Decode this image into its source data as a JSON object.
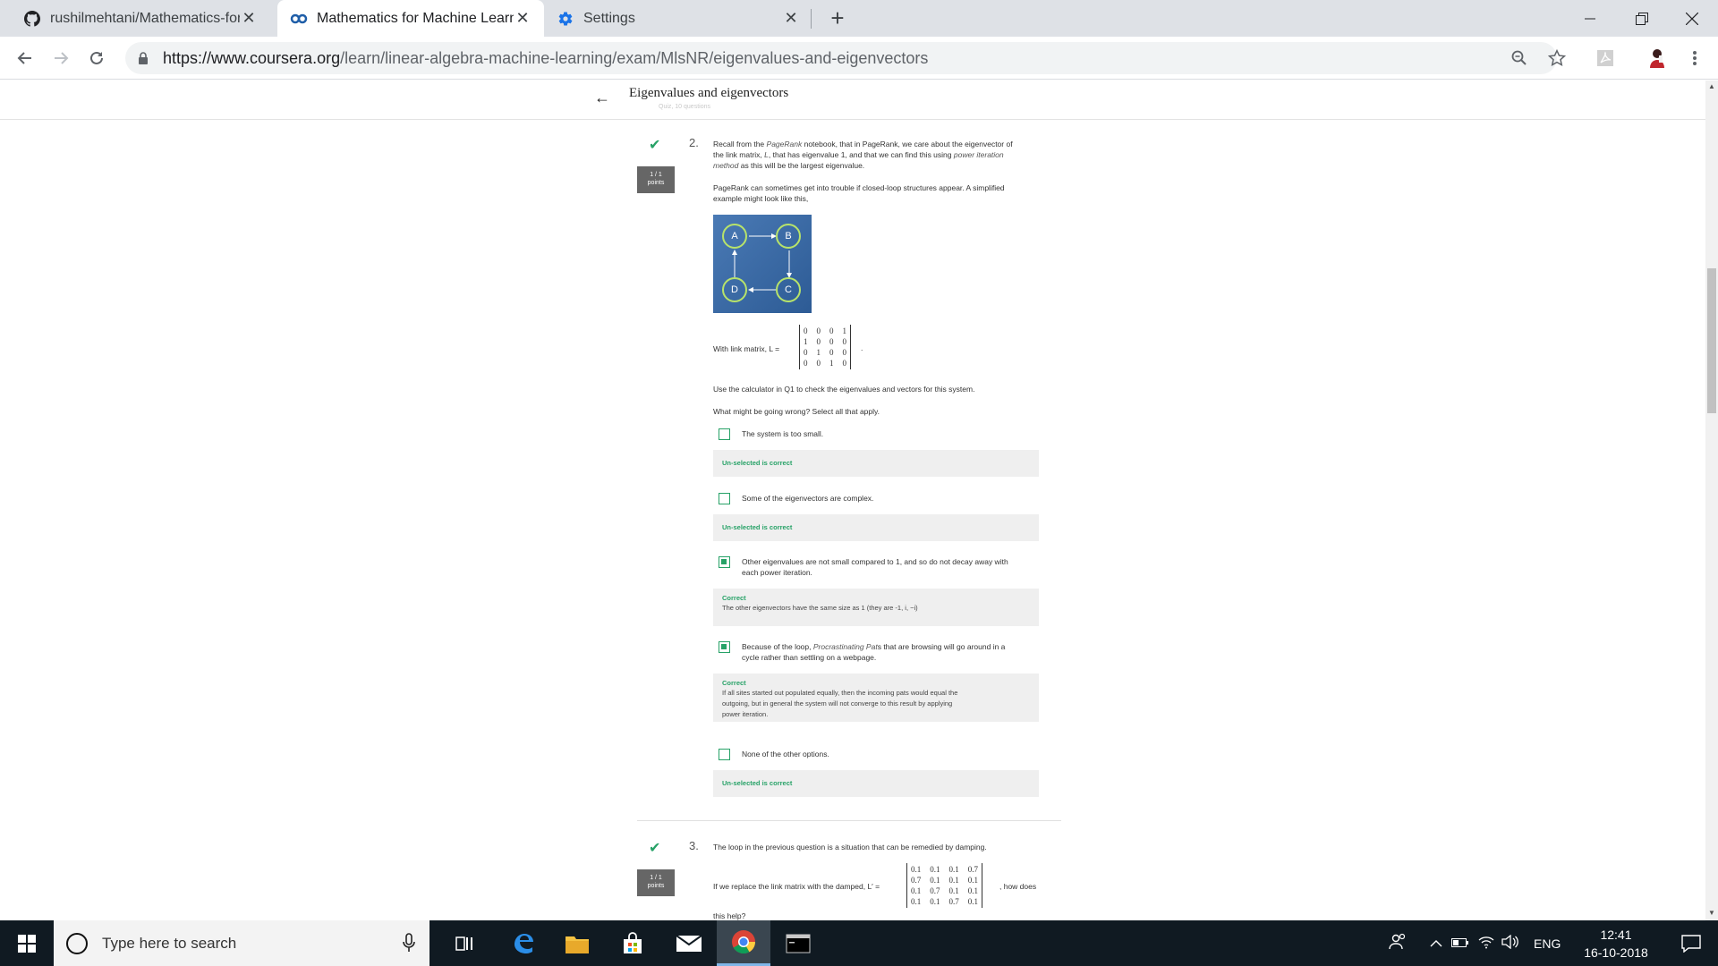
{
  "browser": {
    "tabs": [
      {
        "title": "rushilmehtani/Mathematics-for-M",
        "icon": "github-icon",
        "close": "✕"
      },
      {
        "title": "Mathematics for Machine Learnin",
        "icon": "coursera-icon",
        "close": "✕"
      },
      {
        "title": "Settings",
        "icon": "gear-icon",
        "close": "✕"
      }
    ],
    "new_tab": "+",
    "url_host": "https://www.coursera.org",
    "url_path": "/learn/linear-algebra-machine-learning/exam/MlsNR/eigenvalues-and-eigenvectors"
  },
  "quiz": {
    "title": "Eigenvalues and eigenvectors",
    "subtitle": "Quiz, 10 questions",
    "back": "←"
  },
  "q2": {
    "number": "2.",
    "points_line1": "1 / 1",
    "points_line2": "points",
    "intro_a": "Recall from the ",
    "intro_pagerank_italic": "PageRank",
    "intro_b": " notebook, that in PageRank, we care about the eigenvector of",
    "intro_c": "the link matrix, ",
    "intro_L": "L",
    "intro_d": ", that has eigenvalue 1, and that we can find this using ",
    "intro_power_italic": "power iteration",
    "intro_method_italic": "method",
    "intro_e": " as this will be the largest eigenvalue.",
    "trouble_line1": "PageRank can sometimes get into trouble if closed-loop structures appear. A simplified",
    "trouble_line2": "example might look like this,",
    "nodes": [
      "A",
      "B",
      "C",
      "D"
    ],
    "matrix_label": "With link matrix, L =",
    "matrix_rows": [
      [
        "0",
        "0",
        "0",
        "1"
      ],
      [
        "1",
        "0",
        "0",
        "0"
      ],
      [
        "0",
        "1",
        "0",
        "0"
      ],
      [
        "0",
        "0",
        "1",
        "0"
      ]
    ],
    "matrix_end": ".",
    "calc_note": "Use the calculator in Q1 to check the eigenvalues and vectors for this system.",
    "prompt": "What might be going wrong? Select all that apply.",
    "options": [
      {
        "text": "The system is too small.",
        "fb_title": "Un-selected is correct",
        "fb_body": ""
      },
      {
        "text": "Some of the eigenvectors are complex.",
        "fb_title": "Un-selected is correct",
        "fb_body": ""
      },
      {
        "text_l1": "Other eigenvalues are not small compared to 1, and so do not decay away with",
        "text_l2": "each power iteration.",
        "fb_title": "Correct",
        "fb_body": "The other eigenvectors have the same size as 1 (they are -1, i, −i)"
      },
      {
        "text_l1a": "Because of the loop, ",
        "text_l1_italic": "Procrastinating Pat",
        "text_l1b": "s that are browsing will go around in a",
        "text_l2": "cycle rather than settling on a webpage.",
        "fb_title": "Correct",
        "fb_body_l1": "If all sites started out populated equally, then the incoming pats would equal the",
        "fb_body_l2": "outgoing, but in general the system will not converge to this result by applying",
        "fb_body_l3": "power iteration."
      },
      {
        "text": "None of the other options.",
        "fb_title": "Un-selected is correct",
        "fb_body": ""
      }
    ]
  },
  "q3": {
    "number": "3.",
    "points_line1": "1 / 1",
    "points_line2": "points",
    "intro": "The loop in the previous question is a situation that can be remedied by damping.",
    "replace_a": "If we replace the link matrix with the damped, L′ =",
    "replace_b": ", how does",
    "replace_c": "this help?",
    "matrix_rows": [
      [
        "0.1",
        "0.1",
        "0.1",
        "0.7"
      ],
      [
        "0.7",
        "0.1",
        "0.1",
        "0.1"
      ],
      [
        "0.1",
        "0.7",
        "0.1",
        "0.1"
      ],
      [
        "0.1",
        "0.1",
        "0.7",
        "0.1"
      ]
    ]
  },
  "taskbar": {
    "search_placeholder": "Type here to search",
    "language": "ENG",
    "time": "12:41",
    "date": "16-10-2018"
  },
  "colors": {
    "accent_green": "#27a267",
    "graph_blue": "#3a6aa5",
    "taskbar": "#101a22"
  }
}
